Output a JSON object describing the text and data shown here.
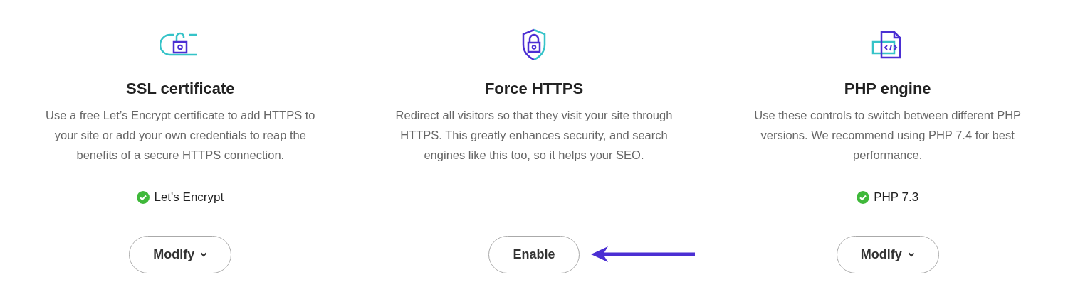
{
  "features": [
    {
      "title": "SSL certificate",
      "description": "Use a free Let’s Encrypt certificate to add HTTPS to your site or add your own credentials to reap the benefits of a secure HTTPS connection.",
      "status": "Let's Encrypt",
      "button": {
        "label": "Modify",
        "dropdown": true
      },
      "arrow": false
    },
    {
      "title": "Force HTTPS",
      "description": "Redirect all visitors so that they visit your site through HTTPS. This greatly enhances security, and search engines like this too, so it helps your SEO.",
      "button": {
        "label": "Enable",
        "dropdown": false
      },
      "arrow": true
    },
    {
      "title": "PHP engine",
      "description": "Use these controls to switch between different PHP versions. We recommend using PHP 7.4 for best performance.",
      "status": "PHP 7.3",
      "button": {
        "label": "Modify",
        "dropdown": true
      },
      "arrow": false
    }
  ]
}
